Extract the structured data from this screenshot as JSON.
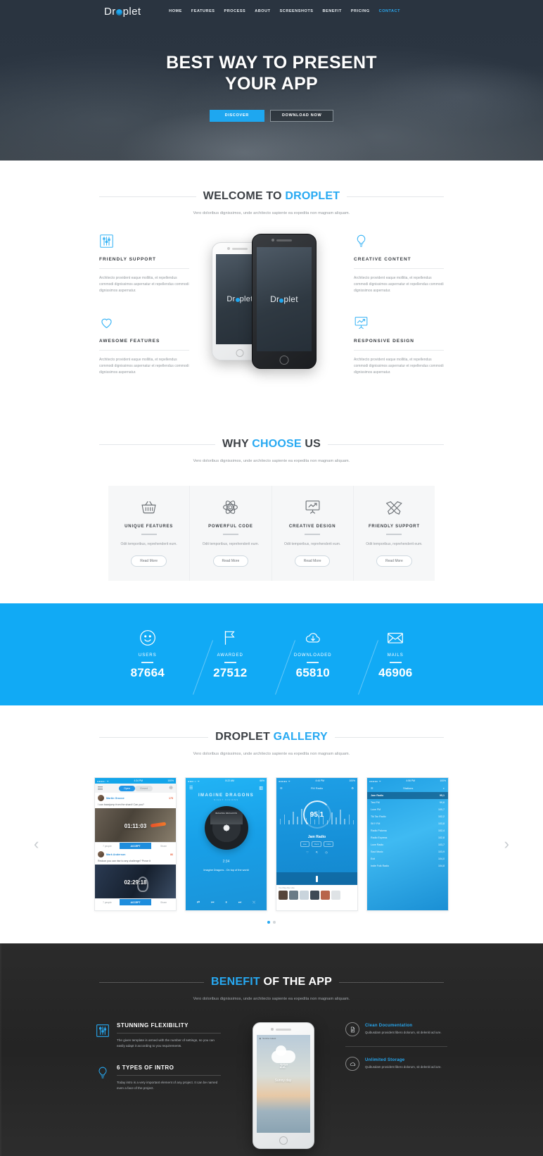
{
  "header": {
    "logo": "Dr",
    "logo_rest": "plet",
    "nav": [
      {
        "label": "HOME",
        "active": false
      },
      {
        "label": "FEATURES",
        "active": false
      },
      {
        "label": "PROCESS",
        "active": false
      },
      {
        "label": "ABOUT",
        "active": false
      },
      {
        "label": "SCREENSHOTS",
        "active": false
      },
      {
        "label": "BENEFIT",
        "active": false
      },
      {
        "label": "PRICING",
        "active": false
      },
      {
        "label": "CONTACT",
        "active": true
      }
    ]
  },
  "hero": {
    "title_line1": "BEST WAY TO PRESENT",
    "title_line2": "YOUR APP",
    "btn_primary": "DISCOVER",
    "btn_secondary": "DOWNLOAD NOW"
  },
  "welcome": {
    "title_plain": "WELCOME TO ",
    "title_hl": "DROPLET",
    "subtitle": "Vero doloribus dignissimos, unde architecto sapiente ea expedita non magnam aliquam.",
    "body": "Architecto provident eaque mollitia, et repellendus commodi dignissimos aspernatur et repellendus commodi dignissimos aspernatur.",
    "features_left": [
      {
        "title": "FRIENDLY SUPPORT",
        "icon": "sliders-icon"
      },
      {
        "title": "AWESOME FEATURES",
        "icon": "heart-icon"
      }
    ],
    "features_right": [
      {
        "title": "CREATIVE CONTENT",
        "icon": "bulb-icon"
      },
      {
        "title": "RESPONSIVE DESIGN",
        "icon": "presentation-chart-icon"
      }
    ],
    "phone_label": "Dr",
    "phone_label_rest": "plet"
  },
  "why": {
    "title_plain1": "WHY ",
    "title_hl": "CHOOSE",
    "title_plain2": " US",
    "subtitle": "Vero doloribus dignissimos, unde architecto sapiente ea expedita non magnam aliquam.",
    "cards": [
      {
        "title": "UNIQUE FEATURES",
        "body": "Odit temporibus, reprehenderit eum.",
        "btn": "Read More",
        "icon": "basket-icon"
      },
      {
        "title": "POWERFUL CODE",
        "body": "Odit temporibus, reprehenderit eum.",
        "btn": "Read More",
        "icon": "atom-icon"
      },
      {
        "title": "CREATIVE DESIGN",
        "body": "Odit temporibus, reprehenderit eum.",
        "btn": "Read More",
        "icon": "presentation-chart-icon"
      },
      {
        "title": "FRIENDLY SUPPORT",
        "body": "Odit temporibus, reprehenderit eum.",
        "btn": "Read More",
        "icon": "pencils-icon"
      }
    ]
  },
  "counters": [
    {
      "label": "USERS",
      "value": "87664",
      "icon": "smiley-icon"
    },
    {
      "label": "AWARDED",
      "value": "27512",
      "icon": "flag-icon"
    },
    {
      "label": "DOWNLOADED",
      "value": "65810",
      "icon": "cloud-download-icon"
    },
    {
      "label": "MAILS",
      "value": "46906",
      "icon": "envelope-icon"
    }
  ],
  "gallery": {
    "title_plain": "DROPLET ",
    "title_hl": "GALLERY",
    "subtitle": "Vero doloribus dignissimos, unde architecto sapiente ea expedita non magnam aliquam.",
    "arrow_left": "‹",
    "arrow_right": "›",
    "shot1": {
      "status_time": "4:34 PM",
      "status_battery": "100%",
      "tab_open": "Open",
      "tab_closed": "Closed",
      "post1": {
        "user": "Martin Groove",
        "points": "175",
        "text": "I can basejump from the shard! Can you?",
        "timer": "01:11:03",
        "people": "7 people",
        "accept": "ACCEPT",
        "share": "Share"
      },
      "post2": {
        "user": "Mark Anderson",
        "points": "86",
        "text": "Reckon you can rise to any challenge? Prove it",
        "timer": "02:29:18",
        "people": "7 people",
        "accept": "ACCEPT",
        "share": "Share"
      }
    },
    "shot2": {
      "status_time": "8:22 AM",
      "status_battery": "66%",
      "band": "IMAGINE DRAGONS",
      "band_sub": "NIGHT VISIONS",
      "sleeve": "IMAGINE DRAGONS",
      "time": "2:34",
      "track": "Imagine Dragons - On top of the world"
    },
    "shot3": {
      "status_time": "4:44 PM",
      "status_battery": "100%",
      "title": "FM Radio",
      "freq": "95,1",
      "station": "Jam Radio",
      "tag1": "Live",
      "tag2": "Rock",
      "tag3": "Indie",
      "footer_label": "You May Also Like"
    },
    "shot4": {
      "status_time": "4:56 PM",
      "status_battery": "100%",
      "title": "Stations",
      "rows": [
        {
          "name": "Jam Radio",
          "freq": "95,1"
        },
        {
          "name": "Test FM",
          "freq": "99,6"
        },
        {
          "name": "Luxe FM",
          "freq": "100,7"
        },
        {
          "name": "Tik Tac Radio",
          "freq": "102,2"
        },
        {
          "name": "SKY FM",
          "freq": "103,8"
        },
        {
          "name": "Radio Paloma",
          "freq": "102,4"
        },
        {
          "name": "Radio Express",
          "freq": "102,8"
        },
        {
          "name": "Love Radio",
          "freq": "103,7"
        },
        {
          "name": "Soul Music",
          "freq": "103,9"
        },
        {
          "name": "Exit",
          "freq": "104,0"
        },
        {
          "name": "Indie Folk Radio",
          "freq": "104,8"
        }
      ]
    }
  },
  "benefit": {
    "title_hl": "BENEFIT",
    "title_plain": " OF THE APP",
    "subtitle": "Vero doloribus dignissimos, unde architecto sapiente ea expedita non magnam aliquam.",
    "left_items": [
      {
        "title": "STUNNING FLEXIBILITY",
        "body": "The given template is armed with the number of settings, so you can easily adapt it according to you requirements.",
        "icon": "sliders-icon"
      },
      {
        "title": "6 TYPES OF INTRO",
        "body": "Today intro is a very important element of any project. It can be named even a face of the project.",
        "icon": "bulb-icon"
      }
    ],
    "right_items": [
      {
        "title": "Clean Documentation",
        "body": "Quibusdam provident libero dolorum, sit deleniti ad iure.",
        "icon": "document-icon"
      },
      {
        "title": "Unlimited Storage",
        "body": "Quibusdam provident libero dolorum, sit deleniti ad iure.",
        "icon": "cloud-icon"
      }
    ],
    "phone": {
      "app_label": "Sunrise Latest",
      "temp": "22°",
      "caption": "Sunny day"
    }
  },
  "colors": {
    "accent": "#27a9f2",
    "counter_bg": "#11aaf5",
    "dark": "#2b3541",
    "benefit_bg": "#2b2b2b"
  }
}
